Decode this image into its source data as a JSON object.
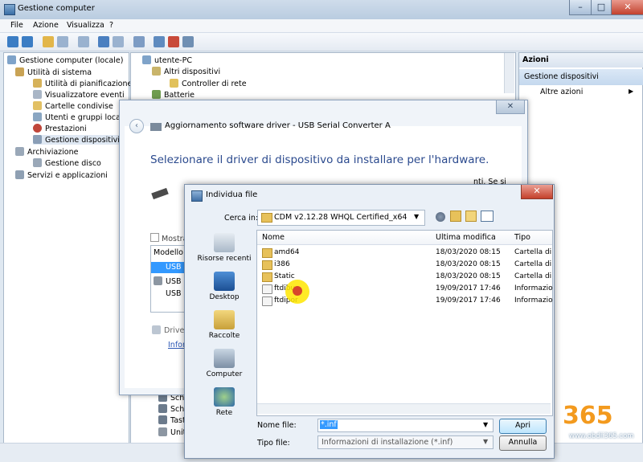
{
  "window": {
    "title": "Gestione computer",
    "minimize": "–",
    "maximize": "□",
    "close": "✕"
  },
  "menu": [
    "File",
    "Azione",
    "Visualizza",
    "?"
  ],
  "left_tree": [
    "Gestione computer (locale)",
    "Utilità di sistema",
    "Utilità di pianificazione",
    "Visualizzatore eventi",
    "Cartelle condivise",
    "Utenti e gruppi locali",
    "Prestazioni",
    "Gestione dispositivi",
    "Archiviazione",
    "Gestione disco",
    "Servizi e applicazioni"
  ],
  "mid_tree": {
    "root": "utente-PC",
    "other_devices": "Altri dispositivi",
    "network_controller": "Controller di rete",
    "batteries": "Batterie",
    "partial": [
      "Sche",
      "Sche",
      "Tasti",
      "Unità"
    ]
  },
  "actions": {
    "header": "Azioni",
    "selected": "Gestione dispositivi",
    "more": "Altre azioni",
    "more_arrow": "▶"
  },
  "wizard": {
    "title": "Aggiornamento software driver - USB Serial Converter A",
    "heading": "Selezionare il driver di dispositivo da installare per l'hardware.",
    "desc_partial": "nti. Se si",
    "show_compat": "Mostra",
    "model_header": "Modello",
    "model_items": [
      "USB",
      "USB",
      "USB"
    ],
    "driver_hint": "Driver",
    "info_link": "Inform"
  },
  "dialog": {
    "title": "Individua file",
    "close": "✕",
    "look_in_label": "Cerca in:",
    "look_in_value": "CDM v2.12.28 WHQL Certified_x64",
    "places": [
      "Risorse recenti",
      "Desktop",
      "Raccolte",
      "Computer",
      "Rete"
    ],
    "columns": [
      "Nome",
      "Ultima modifica",
      "Tipo"
    ],
    "files": [
      {
        "name": "amd64",
        "modified": "18/03/2020 08:15",
        "type": "Cartella di"
      },
      {
        "name": "i386",
        "modified": "18/03/2020 08:15",
        "type": "Cartella di"
      },
      {
        "name": "Static",
        "modified": "18/03/2020 08:15",
        "type": "Cartella di"
      },
      {
        "name": "ftdibu",
        "modified": "19/09/2017 17:46",
        "type": "Informazio"
      },
      {
        "name": "ftdipor",
        "modified": "19/09/2017 17:46",
        "type": "Informazio"
      }
    ],
    "file_name_label": "Nome file:",
    "file_name_value": "*.inf",
    "file_type_label": "Tipo file:",
    "file_type_value": "Informazioni di installazione (*.inf)",
    "open_button": "Apri",
    "cancel_button": "Annulla"
  },
  "watermark": {
    "logo_text": "365",
    "url": "www.obdii365.com"
  },
  "colors": {
    "accent_heading": "#2b4a8e",
    "close_red": "#c4402b",
    "selection_blue": "#3399ff",
    "logo_orange": "#f39a1e"
  }
}
